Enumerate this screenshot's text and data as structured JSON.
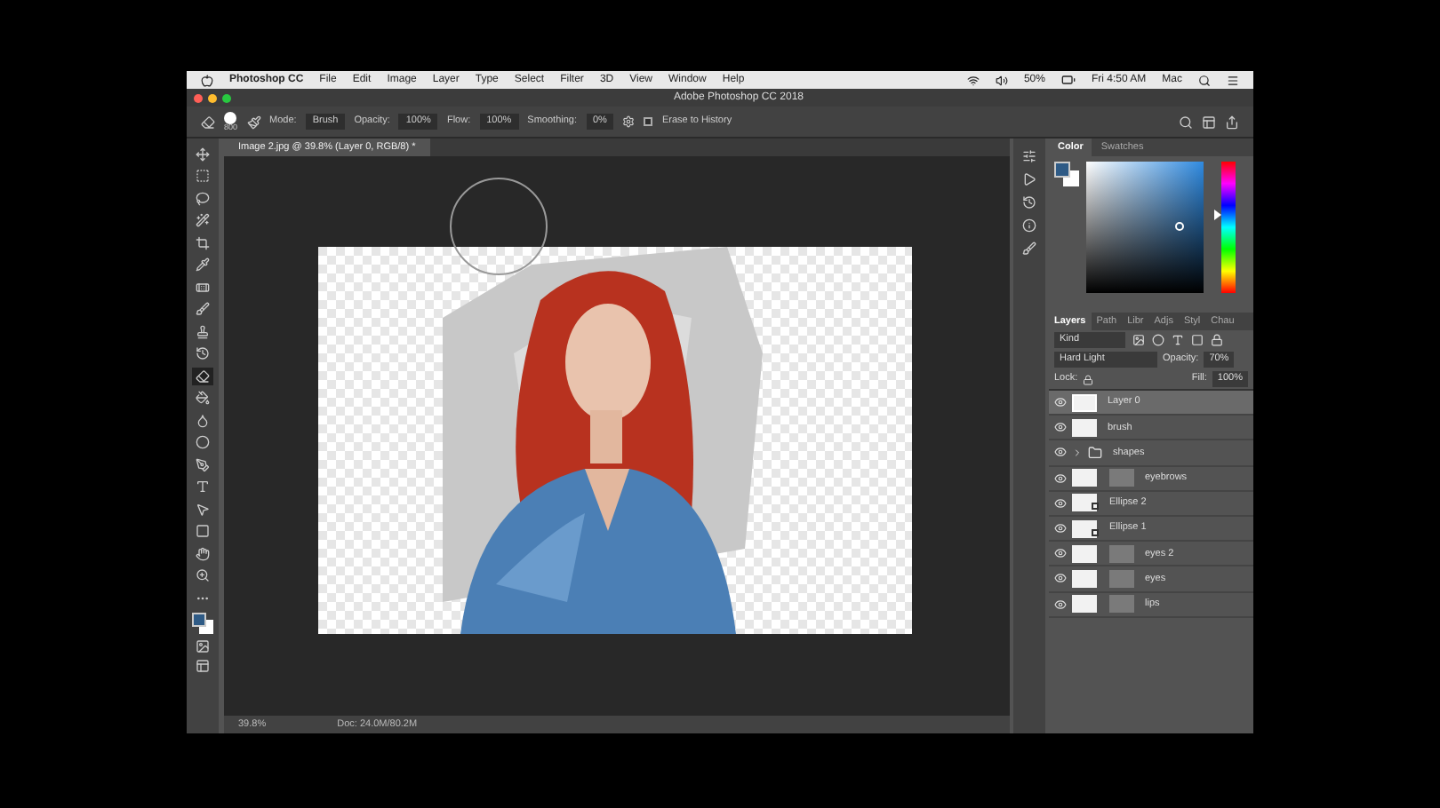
{
  "menu_bar": {
    "app": "Photoshop CC",
    "menus": [
      "File",
      "Edit",
      "Image",
      "Layer",
      "Type",
      "Select",
      "Filter",
      "3D",
      "View",
      "Window",
      "Help"
    ],
    "battery": "50%",
    "clock": "Fri 4:50 AM",
    "user": "Mac"
  },
  "window": {
    "title": "Adobe Photoshop CC 2018"
  },
  "options_bar": {
    "brush_size": "800",
    "mode_label": "Mode:",
    "mode": "Brush",
    "opacity_label": "Opacity:",
    "opacity": "100%",
    "flow_label": "Flow:",
    "flow": "100%",
    "smoothing_label": "Smoothing:",
    "smoothing": "0%",
    "erase_to_history": {
      "label": "Erase to History",
      "checked": false
    }
  },
  "tools": [
    {
      "selected": false
    },
    {
      "selected": false
    },
    {
      "selected": false
    },
    {
      "selected": false
    },
    {
      "selected": false
    },
    {
      "selected": false
    },
    {
      "selected": false
    },
    {
      "selected": false
    },
    {
      "selected": false
    },
    {
      "selected": false
    },
    {
      "selected": true
    },
    {
      "selected": false
    },
    {
      "selected": false
    },
    {
      "selected": false
    },
    {
      "selected": false
    },
    {
      "selected": false
    },
    {
      "selected": false
    },
    {
      "selected": false
    },
    {
      "selected": false
    },
    {
      "selected": false
    },
    {
      "selected": false
    }
  ],
  "document": {
    "tab": "Image 2.jpg @ 39.8% (Layer 0, RGB/8) *",
    "zoom": "39.8%",
    "doc_size": "Doc: 24.0M/80.2M"
  },
  "color_panel": {
    "hue": {
      "level": 0.6
    },
    "tabs": [
      {
        "label": "Color",
        "selected": true
      },
      {
        "label": "Swatches",
        "selected": false
      }
    ]
  },
  "layers_panel": {
    "tabs": [
      {
        "label": "Layers",
        "selected": true
      },
      {
        "label": "Path",
        "selected": false
      },
      {
        "label": "Libr",
        "selected": false
      },
      {
        "label": "Adjs",
        "selected": false
      },
      {
        "label": "Styl",
        "selected": false
      },
      {
        "label": "Chau",
        "selected": false
      }
    ],
    "filter": "Kind",
    "blend_mode": "Hard Light",
    "opacity_label": "Opacity:",
    "opacity": "70%",
    "lock_label": "Lock:",
    "fill_label": "Fill:",
    "fill": "100%",
    "layers": [
      {
        "name": "Layer 0",
        "kind": "pixel",
        "selected": true,
        "visible": true
      },
      {
        "name": "brush",
        "kind": "pixel",
        "selected": false,
        "visible": true
      },
      {
        "name": "shapes",
        "kind": "group",
        "selected": false,
        "visible": true
      },
      {
        "name": "eyebrows",
        "kind": "masked",
        "selected": false,
        "visible": true
      },
      {
        "name": "Ellipse 2",
        "kind": "shape",
        "selected": false,
        "visible": true
      },
      {
        "name": "Ellipse 1",
        "kind": "shape",
        "selected": false,
        "visible": true
      },
      {
        "name": "eyes 2",
        "kind": "masked",
        "selected": false,
        "visible": true
      },
      {
        "name": "eyes",
        "kind": "masked",
        "selected": false,
        "visible": true
      },
      {
        "name": "lips",
        "kind": "masked",
        "selected": false,
        "visible": true
      }
    ]
  }
}
